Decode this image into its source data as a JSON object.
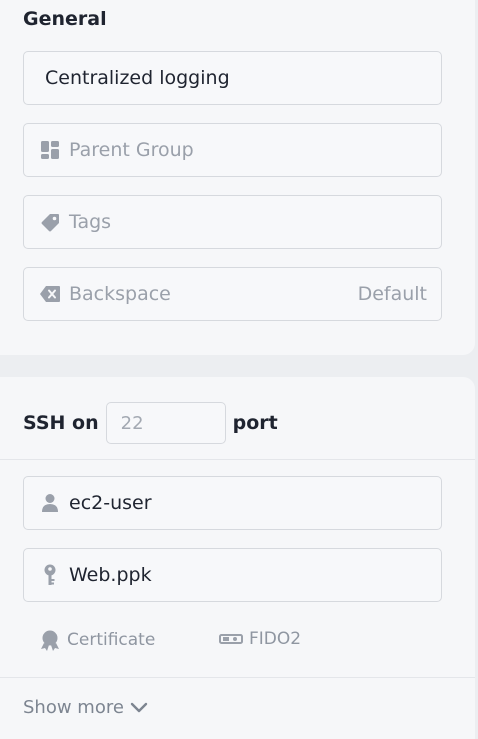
{
  "general": {
    "title": "General",
    "label_value": "Centralized logging",
    "parent_group_placeholder": "Parent Group",
    "tags_placeholder": "Tags",
    "backspace_label": "Backspace",
    "backspace_value": "Default"
  },
  "ssh": {
    "prefix": "SSH on",
    "port_placeholder": "22",
    "suffix": "port",
    "username": "ec2-user",
    "key": "Web.ppk",
    "certificate_label": "Certificate",
    "fido2_label": "FIDO2",
    "show_more_label": "Show more"
  },
  "icons": {
    "parent_group": "parent-group-icon",
    "tags": "tag-icon",
    "backspace": "backspace-icon",
    "user": "user-icon",
    "key": "key-icon",
    "certificate": "certificate-icon",
    "fido2": "fido2-icon",
    "chevron": "chevron-down-icon"
  },
  "colors": {
    "card_bg": "#f6f7f9",
    "border": "#d6d9de",
    "text": "#1f2430",
    "muted": "#9aa0aa"
  }
}
